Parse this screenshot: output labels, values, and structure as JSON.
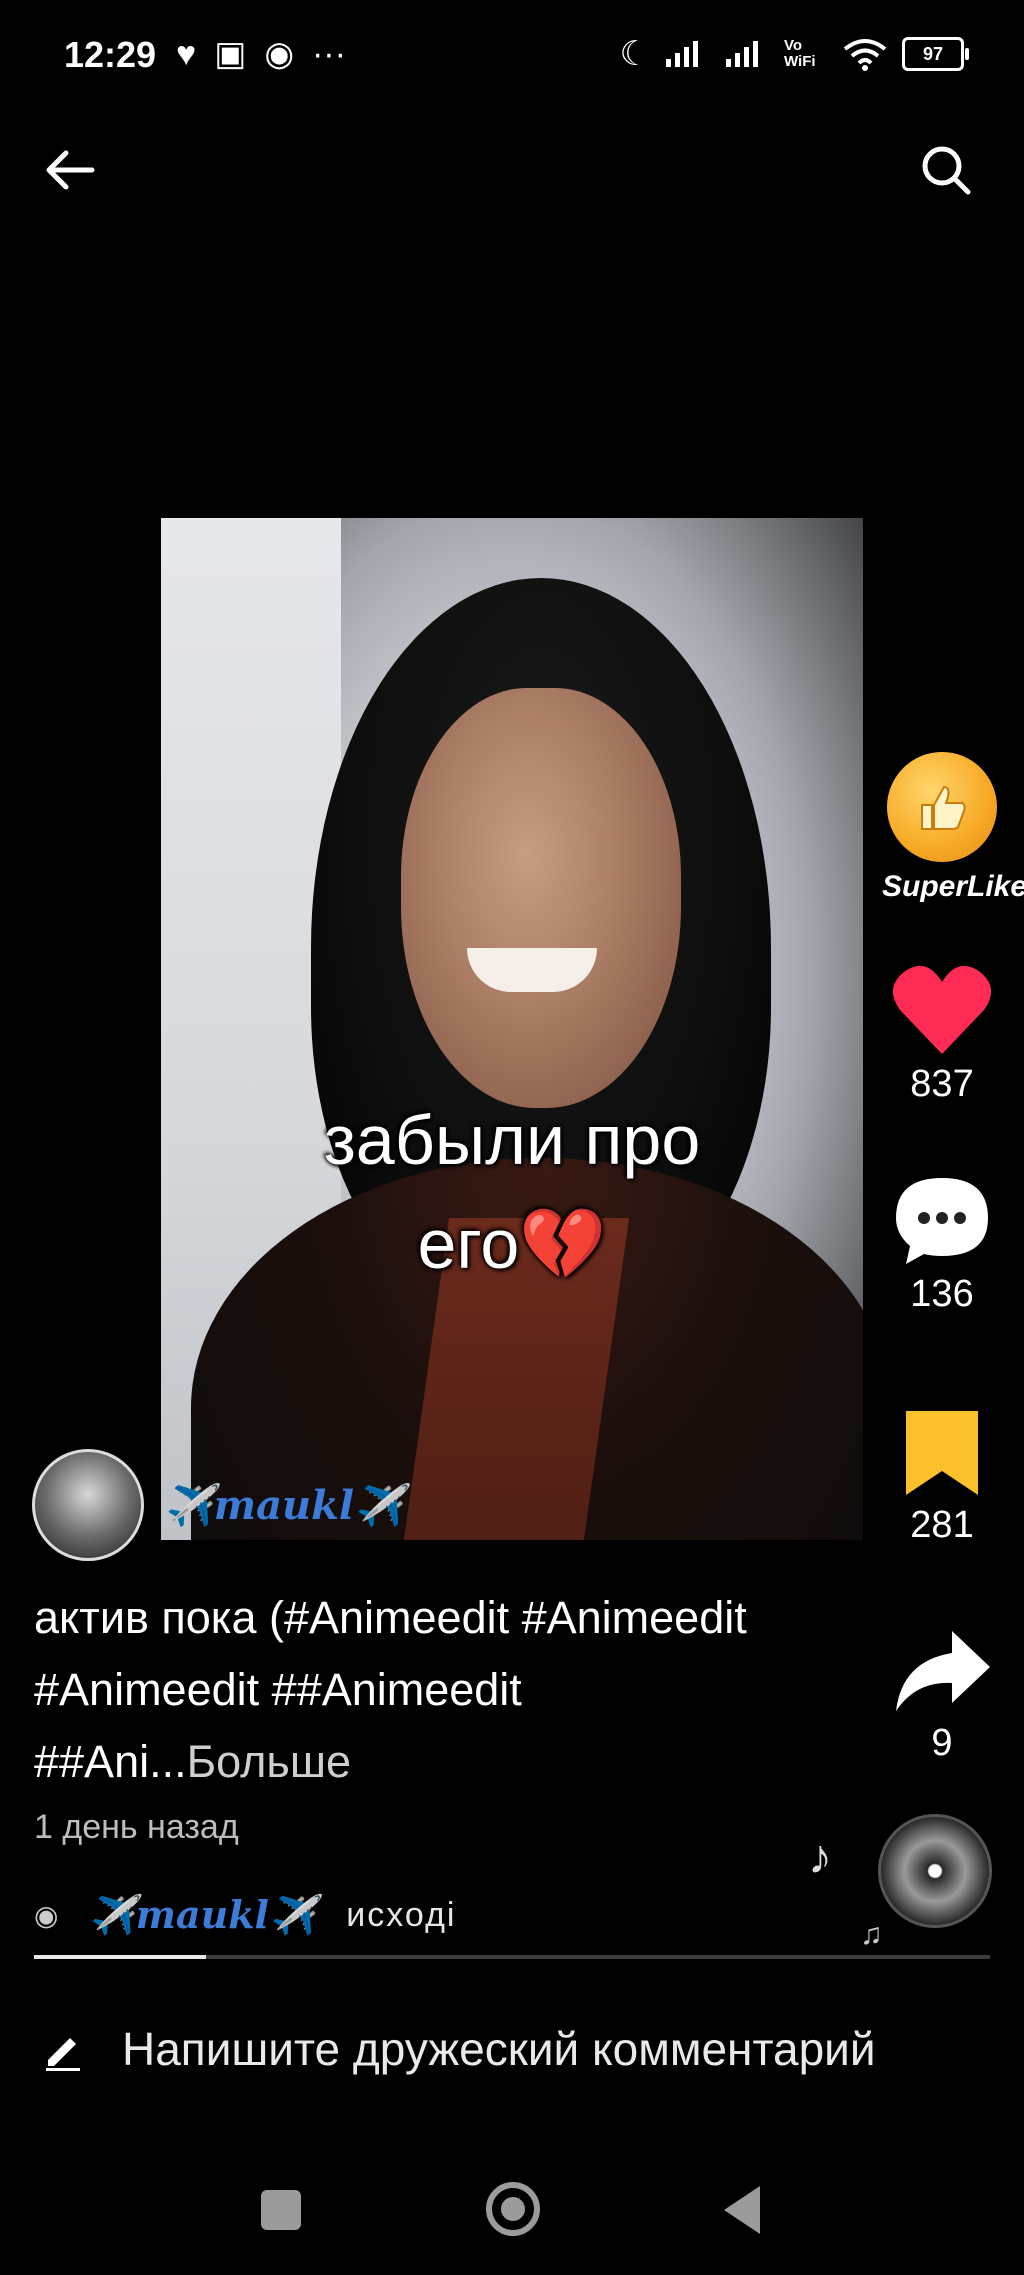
{
  "status_bar": {
    "time": "12:29",
    "battery": "97",
    "network": "Vo WiFi",
    "left_icons": [
      "heart-icon",
      "image-icon",
      "chat-icon",
      "more-dots-icon"
    ],
    "more": "···"
  },
  "nav": {
    "back_icon": "arrow-left-icon",
    "search_icon": "search-icon"
  },
  "video": {
    "overlay_line1": "забыли про",
    "overlay_line2": "его",
    "overlay_emoji": "💔"
  },
  "actions": {
    "superlike_label": "SuperLike",
    "likes": "837",
    "comments": "136",
    "saves": "281",
    "shares": "9",
    "colors": {
      "like": "#fe2c55",
      "save": "#fcc02c",
      "superlike": "#f7a925"
    }
  },
  "author": {
    "name": "✈️maukl✈️"
  },
  "caption": {
    "text": "актив пока (#Animeedit #Animeedit #Animeedit ##Animeedit ##Ani...",
    "more": "Больше",
    "time_ago": "1 день назад"
  },
  "music": {
    "author": "✈️maukl✈️",
    "title": "исході"
  },
  "progress": {
    "fraction": 0.18
  },
  "comment": {
    "placeholder": "Напишите дружеский комментарий"
  }
}
